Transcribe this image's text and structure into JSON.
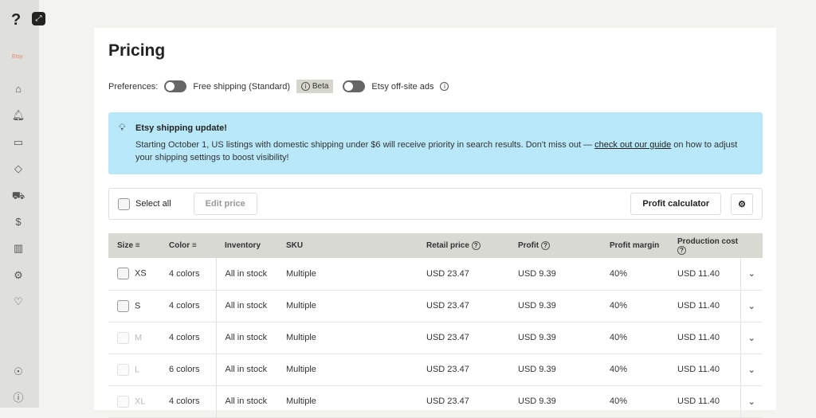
{
  "sidebar": {
    "brand": "Etsy",
    "items": [
      "home",
      "notifications",
      "orders",
      "tags",
      "shipping",
      "pricing",
      "analytics",
      "settings",
      "favorites"
    ],
    "bottom": [
      "awards",
      "help"
    ]
  },
  "page": {
    "title": "Pricing"
  },
  "prefs": {
    "label": "Preferences:",
    "free_shipping": "Free shipping (Standard)",
    "beta": "Beta",
    "offsite_ads": "Etsy off-site ads"
  },
  "banner": {
    "title": "Etsy shipping update!",
    "text_before": "Starting October 1, US listings with domestic shipping under $6 will receive priority in search results. Don't miss out — ",
    "link": "check out our guide",
    "text_after": " on how to adjust your shipping settings to boost visibility!"
  },
  "toolbar": {
    "select_all": "Select all",
    "edit_price": "Edit price",
    "profit_calculator": "Profit calculator"
  },
  "table": {
    "headers": [
      "Size",
      "Color",
      "Inventory",
      "SKU",
      "Retail price",
      "Profit",
      "Profit margin",
      "Production cost"
    ],
    "rows": [
      [
        "XS",
        "4 colors",
        "All in stock",
        "Multiple",
        "USD 23.47",
        "USD 9.39",
        "40%",
        "USD 11.40"
      ],
      [
        "S",
        "4 colors",
        "All in stock",
        "Multiple",
        "USD 23.47",
        "USD 9.39",
        "40%",
        "USD 11.40"
      ],
      [
        "M",
        "4 colors",
        "All in stock",
        "Multiple",
        "USD 23.47",
        "USD 9.39",
        "40%",
        "USD 11.40"
      ],
      [
        "L",
        "6 colors",
        "All in stock",
        "Multiple",
        "USD 23.47",
        "USD 9.39",
        "40%",
        "USD 11.40"
      ],
      [
        "XL",
        "4 colors",
        "All in stock",
        "Multiple",
        "USD 23.47",
        "USD 9.39",
        "40%",
        "USD 11.40"
      ]
    ]
  }
}
